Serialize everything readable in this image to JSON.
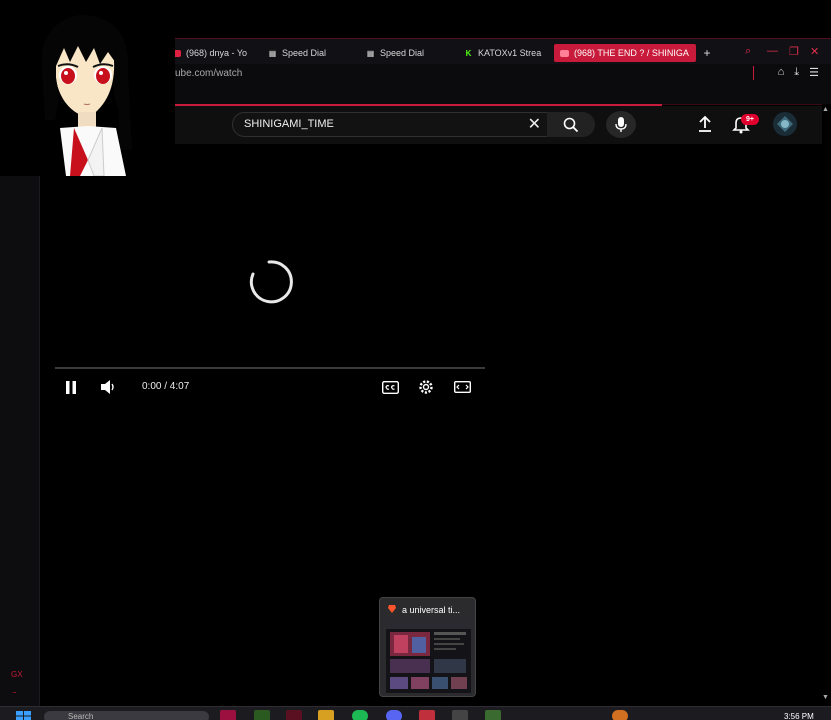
{
  "browser": {
    "tabs": [
      {
        "label": "(968) dnya - Yo",
        "icon": "youtube-icon"
      },
      {
        "label": "Speed Dial",
        "icon": "grid-icon"
      },
      {
        "label": "Speed Dial",
        "icon": "grid-icon"
      },
      {
        "label": "KATOXv1 Strea",
        "icon": "kick-icon"
      },
      {
        "label": "(968) THE END ? / SHINIGA",
        "icon": "youtube-icon",
        "active": true
      }
    ],
    "url": "ube.com/watch",
    "accent": "#c81a3a"
  },
  "youtube": {
    "search_value": "SHINIGAMI_TIME",
    "notification_badge": "9+"
  },
  "player": {
    "time_display": "0:00 / 4:07",
    "state": "loading"
  },
  "preview": {
    "title": "a universal ti..."
  },
  "taskbar": {
    "search_placeholder": "Search",
    "clock": "3:56 PM"
  },
  "sidebar": {
    "logo_text": "GX",
    "more_text": "..."
  }
}
